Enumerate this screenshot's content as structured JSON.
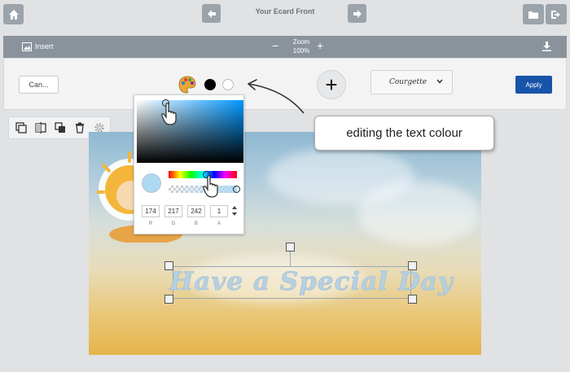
{
  "header": {
    "title": "Your Ecard Front"
  },
  "insert_bar": {
    "insert_label": "Insert",
    "zoom_label": "Zoom",
    "zoom_value": "100%",
    "zoom_minus": "−",
    "zoom_plus": "+"
  },
  "text_bar": {
    "cancel_label": "Can...",
    "add_label": "+",
    "font_value": "Courgette",
    "apply_label": "Apply",
    "swatches": [
      "#000000",
      "#ffffff"
    ]
  },
  "canvas": {
    "text": "Have a Special Day"
  },
  "color_picker": {
    "r": "174",
    "g": "217",
    "b": "242",
    "a": "1",
    "r_label": "R",
    "g_label": "G",
    "b_label": "B",
    "a_label": "A",
    "color": "#aed9f2"
  },
  "annotation": {
    "text": "editing the text colour"
  },
  "colors": {
    "accent": "#1754a8",
    "toolbar": "#8a939b",
    "icon_button": "#9ba3ab"
  }
}
